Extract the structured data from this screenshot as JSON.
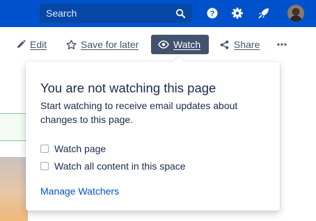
{
  "header": {
    "search_placeholder": "Search",
    "icons": [
      "search-icon",
      "help-icon",
      "settings-icon",
      "notifications-icon",
      "avatar"
    ],
    "brand_color": "#0052cc"
  },
  "toolbar": {
    "edit_label": "Edit",
    "save_label": "Save for later",
    "watch_label": "Watch",
    "share_label": "Share",
    "more_label": "···"
  },
  "watch_popup": {
    "title": "You are not watching this page",
    "description": "Start watching to receive email updates about changes to this page.",
    "options": [
      {
        "label": "Watch page",
        "checked": false
      },
      {
        "label": "Watch all content in this space",
        "checked": false
      }
    ],
    "manage_link": "Manage Watchers"
  }
}
